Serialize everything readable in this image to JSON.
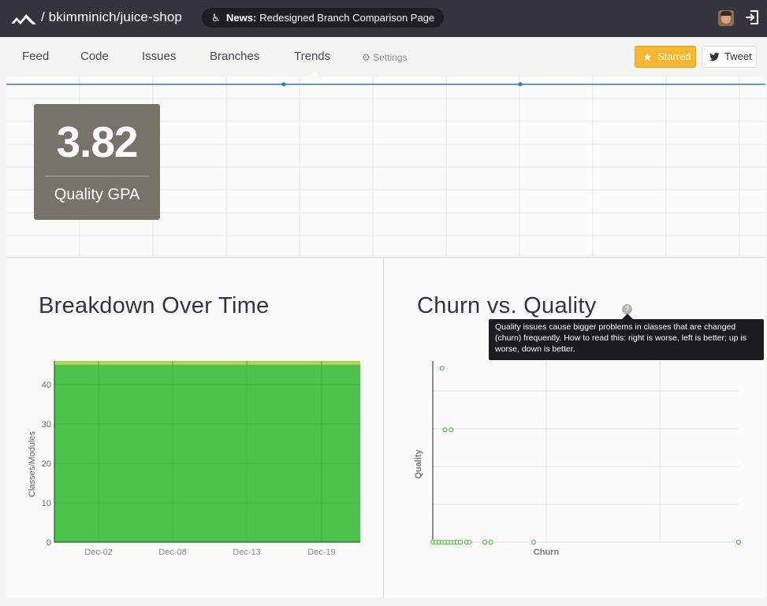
{
  "header": {
    "repo": "/ bkimminich/juice-shop",
    "news_label": "News:",
    "news_text": "Redesigned Branch Comparison Page",
    "logo_icon": "codeclimate-logo-icon",
    "news_icon": "antenna-icon",
    "logout_icon": "sign-out-icon"
  },
  "nav": {
    "items": [
      "Feed",
      "Code",
      "Issues",
      "Branches",
      "Trends"
    ],
    "active": "Trends",
    "settings": "Settings",
    "starred_label": "Starred",
    "tweet_label": "Tweet"
  },
  "gpa": {
    "value": "3.82",
    "label": "Quality GPA"
  },
  "breakdown": {
    "title": "Breakdown Over Time"
  },
  "churn": {
    "title": "Churn vs. Quality",
    "help": "?",
    "tooltip": "Quality issues cause bigger problems in classes that are changed (churn) frequently. How to read this: right is worse, left is better; up is worse, down is better."
  },
  "colors": {
    "topbar": "#33353d",
    "starred": "#f8b731",
    "area_green": "#4cc24c",
    "area_top": "#a5d65a",
    "point_green": "#67c85a",
    "trend_line": "#2b7bbf"
  },
  "chart_data": [
    {
      "type": "line",
      "x": [
        "",
        "",
        ""
      ],
      "y": [
        3.82,
        3.82,
        3.82
      ],
      "grid": true
    },
    {
      "type": "area",
      "title": "Breakdown Over Time",
      "categories": [
        "Dec-02",
        "Dec-08",
        "Dec-13",
        "Dec-19"
      ],
      "ylabel": "Classes/Modules",
      "yticks": [
        0,
        10,
        20,
        30,
        40
      ],
      "ylim": [
        0,
        46
      ],
      "series": [
        {
          "values": [
            45,
            45,
            45,
            45
          ],
          "color": "#4cc24c"
        },
        {
          "values": [
            1,
            1,
            1,
            1
          ],
          "color": "#a5d65a"
        }
      ],
      "grid": true
    },
    {
      "type": "scatter",
      "title": "Churn vs. Quality",
      "xlabel": "Churn",
      "ylabel": "Quality",
      "xlim": [
        0,
        100
      ],
      "ylim": [
        0,
        50
      ],
      "grid": true,
      "points": [
        {
          "x": 3,
          "y": 48
        },
        {
          "x": 4,
          "y": 31
        },
        {
          "x": 6,
          "y": 31
        },
        {
          "x": 0,
          "y": 0
        },
        {
          "x": 1,
          "y": 0
        },
        {
          "x": 2,
          "y": 0
        },
        {
          "x": 3,
          "y": 0
        },
        {
          "x": 4,
          "y": 0
        },
        {
          "x": 5,
          "y": 0
        },
        {
          "x": 6,
          "y": 0
        },
        {
          "x": 7,
          "y": 0
        },
        {
          "x": 8,
          "y": 0
        },
        {
          "x": 9,
          "y": 0
        },
        {
          "x": 11,
          "y": 0
        },
        {
          "x": 12,
          "y": 0
        },
        {
          "x": 17,
          "y": 0
        },
        {
          "x": 19,
          "y": 0
        },
        {
          "x": 33,
          "y": 0
        },
        {
          "x": 100,
          "y": 0
        }
      ]
    }
  ]
}
